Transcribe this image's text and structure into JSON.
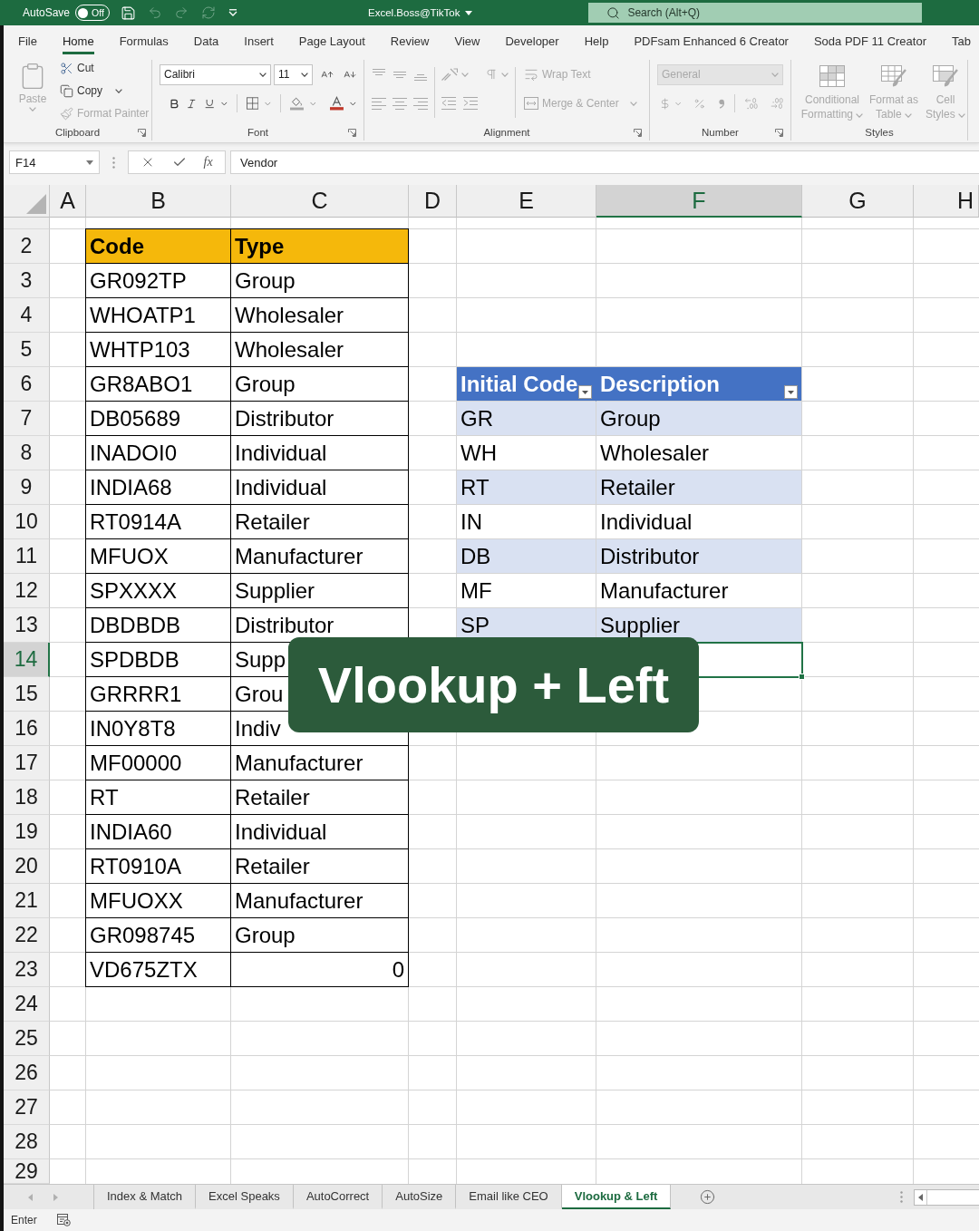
{
  "title_bar": {
    "autosave": {
      "label": "AutoSave",
      "state_label": "Off",
      "on": false
    },
    "account": "Excel.Boss@TikTok",
    "search": {
      "placeholder": "Search (Alt+Q)"
    }
  },
  "ribbon_tabs": [
    {
      "label": "File",
      "selected": false
    },
    {
      "label": "Home",
      "selected": true
    },
    {
      "label": "Formulas",
      "selected": false
    },
    {
      "label": "Data",
      "selected": false
    },
    {
      "label": "Insert",
      "selected": false
    },
    {
      "label": "Page Layout",
      "selected": false
    },
    {
      "label": "Review",
      "selected": false
    },
    {
      "label": "View",
      "selected": false
    },
    {
      "label": "Developer",
      "selected": false
    },
    {
      "label": "Help",
      "selected": false
    },
    {
      "label": "PDFsam Enhanced 6 Creator",
      "selected": false
    },
    {
      "label": "Soda PDF 11 Creator",
      "selected": false
    },
    {
      "label": "Tab",
      "selected": false
    }
  ],
  "ribbon": {
    "clipboard": {
      "label": "Clipboard",
      "paste": {
        "label": "Paste",
        "disabled": true
      },
      "cut": {
        "label": "Cut",
        "disabled": false
      },
      "copy": {
        "label": "Copy",
        "disabled": false
      },
      "format_painter": {
        "label": "Format Painter",
        "disabled": true
      }
    },
    "font": {
      "label": "Font",
      "font_name": "Calibri",
      "font_size": "11"
    },
    "alignment": {
      "label": "Alignment",
      "disabled": true,
      "wrap_text": "Wrap Text",
      "merge_center": "Merge & Center"
    },
    "number": {
      "label": "Number",
      "disabled": true,
      "format": "General"
    },
    "styles": {
      "label": "Styles",
      "disabled": true,
      "buttons": [
        "Conditional Formatting",
        "Format as Table",
        "Cell Styles"
      ]
    }
  },
  "formula_bar": {
    "name_box": "F14",
    "function_label": "fx",
    "value": "Vendor"
  },
  "columns": [
    {
      "label": "A",
      "selected": false
    },
    {
      "label": "B",
      "selected": false
    },
    {
      "label": "C",
      "selected": false
    },
    {
      "label": "D",
      "selected": false
    },
    {
      "label": "E",
      "selected": false
    },
    {
      "label": "F",
      "selected": true
    },
    {
      "label": "G",
      "selected": false
    },
    {
      "label": "H",
      "selected": false
    }
  ],
  "rows": [
    {
      "label": "2",
      "selected": false
    },
    {
      "label": "3",
      "selected": false
    },
    {
      "label": "4",
      "selected": false
    },
    {
      "label": "5",
      "selected": false
    },
    {
      "label": "6",
      "selected": false
    },
    {
      "label": "7",
      "selected": false
    },
    {
      "label": "8",
      "selected": false
    },
    {
      "label": "9",
      "selected": false
    },
    {
      "label": "10",
      "selected": false
    },
    {
      "label": "11",
      "selected": false
    },
    {
      "label": "12",
      "selected": false
    },
    {
      "label": "13",
      "selected": false
    },
    {
      "label": "14",
      "selected": true
    },
    {
      "label": "15",
      "selected": false
    },
    {
      "label": "16",
      "selected": false
    },
    {
      "label": "17",
      "selected": false
    },
    {
      "label": "18",
      "selected": false
    },
    {
      "label": "19",
      "selected": false
    },
    {
      "label": "20",
      "selected": false
    },
    {
      "label": "21",
      "selected": false
    },
    {
      "label": "22",
      "selected": false
    },
    {
      "label": "23",
      "selected": false
    },
    {
      "label": "24",
      "selected": false
    },
    {
      "label": "25",
      "selected": false
    },
    {
      "label": "26",
      "selected": false
    },
    {
      "label": "27",
      "selected": false
    },
    {
      "label": "28",
      "selected": false
    },
    {
      "label": "29",
      "selected": false
    }
  ],
  "code_table": {
    "header": [
      "Code",
      "Type"
    ],
    "rows": [
      {
        "code": "GR092TP",
        "type": "Group",
        "kind": "text"
      },
      {
        "code": "WHOATP1",
        "type": "Wholesaler",
        "kind": "text"
      },
      {
        "code": "WHTP103",
        "type": "Wholesaler",
        "kind": "text"
      },
      {
        "code": "GR8ABO1",
        "type": "Group",
        "kind": "text"
      },
      {
        "code": "DB05689",
        "type": "Distributor",
        "kind": "text"
      },
      {
        "code": "INADOI0",
        "type": "Individual",
        "kind": "text"
      },
      {
        "code": "INDIA68",
        "type": "Individual",
        "kind": "text"
      },
      {
        "code": "RT0914A",
        "type": "Retailer",
        "kind": "text"
      },
      {
        "code": "MFUOX",
        "type": "Manufacturer",
        "kind": "text"
      },
      {
        "code": "SPXXXX",
        "type": "Supplier",
        "kind": "text"
      },
      {
        "code": "DBDBDB",
        "type": "Distributor",
        "kind": "text"
      },
      {
        "code": "SPDBDB",
        "type": "Supp",
        "kind": "text"
      },
      {
        "code": "GRRRR1",
        "type": "Grou",
        "kind": "text"
      },
      {
        "code": "IN0Y8T8",
        "type": "Indiv",
        "kind": "text"
      },
      {
        "code": "MF00000",
        "type": "Manufacturer",
        "kind": "text"
      },
      {
        "code": "RT",
        "type": "Retailer",
        "kind": "text"
      },
      {
        "code": "INDIA60",
        "type": "Individual",
        "kind": "text"
      },
      {
        "code": "RT0910A",
        "type": "Retailer",
        "kind": "text"
      },
      {
        "code": "MFUOXX",
        "type": "Manufacturer",
        "kind": "text"
      },
      {
        "code": "GR098745",
        "type": "Group",
        "kind": "text"
      },
      {
        "code": "VD675ZTX",
        "type": "0",
        "kind": "number"
      }
    ]
  },
  "lookup_table": {
    "header": [
      "Initial Code",
      "Description"
    ],
    "rows": [
      {
        "code": "GR",
        "description": "Group"
      },
      {
        "code": "WH",
        "description": "Wholesaler"
      },
      {
        "code": "RT",
        "description": "Retailer"
      },
      {
        "code": "IN",
        "description": "Individual"
      },
      {
        "code": "DB",
        "description": "Distributor"
      },
      {
        "code": "MF",
        "description": "Manufacturer"
      },
      {
        "code": "SP",
        "description": "Supplier"
      }
    ]
  },
  "caption_overlay": {
    "text": "Vlookup + Left"
  },
  "sheet_tabs": [
    {
      "label": "Index & Match",
      "selected": false
    },
    {
      "label": "Excel Speaks",
      "selected": false
    },
    {
      "label": "AutoCorrect",
      "selected": false
    },
    {
      "label": "AutoSize",
      "selected": false
    },
    {
      "label": "Email like CEO",
      "selected": false
    },
    {
      "label": "Vlookup & Left",
      "selected": true
    }
  ],
  "status_bar": {
    "mode": "Enter"
  }
}
